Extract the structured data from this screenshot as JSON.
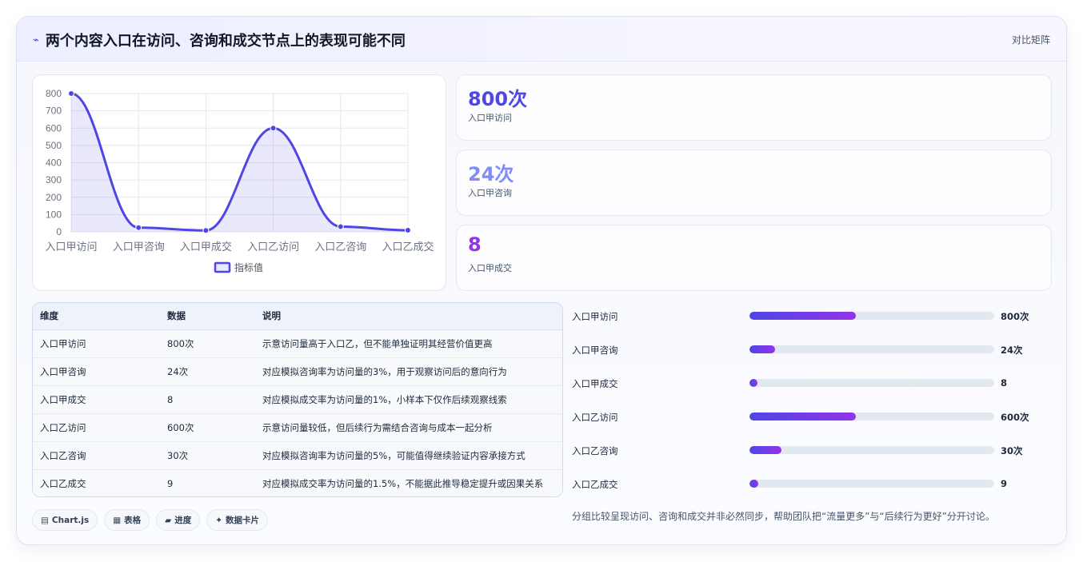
{
  "header": {
    "title": "两个内容入口在访问、咨询和成交节点上的表现可能不同",
    "title_icon": "trend-icon",
    "right_label": "对比矩阵"
  },
  "chart_data": {
    "type": "line",
    "categories": [
      "入口甲访问",
      "入口甲咨询",
      "入口甲成交",
      "入口乙访问",
      "入口乙咨询",
      "入口乙成交"
    ],
    "series": [
      {
        "name": "指标值",
        "values": [
          800,
          24,
          8,
          600,
          30,
          9
        ],
        "color": "#4f46e5"
      }
    ],
    "yticks": [
      "800",
      "700",
      "600",
      "500",
      "400",
      "300",
      "200",
      "100",
      "0"
    ],
    "ylim": [
      0,
      800
    ],
    "grid": true,
    "fill": true,
    "legend": "bottom"
  },
  "stats": [
    {
      "value": "800次",
      "label": "入口甲访问",
      "color": "#4f46e5"
    },
    {
      "value": "24次",
      "label": "入口甲咨询",
      "color": "#818cf8"
    },
    {
      "value": "8",
      "label": "入口甲成交",
      "color": "#9333ea"
    }
  ],
  "table": {
    "headers": [
      "维度",
      "数据",
      "说明"
    ],
    "rows": [
      [
        "入口甲访问",
        "800次",
        "示意访问量高于入口乙，但不能单独证明其经营价值更高"
      ],
      [
        "入口甲咨询",
        "24次",
        "对应模拟咨询率为访问量的3%，用于观察访问后的意向行为"
      ],
      [
        "入口甲成交",
        "8",
        "对应模拟成交率为访问量的1%，小样本下仅作后续观察线索"
      ],
      [
        "入口乙访问",
        "600次",
        "示意访问量较低，但后续行为需结合咨询与成本一起分析"
      ],
      [
        "入口乙咨询",
        "30次",
        "对应模拟咨询率为访问量的5%，可能值得继续验证内容承接方式"
      ],
      [
        "入口乙成交",
        "9",
        "对应模拟成交率为访问量的1.5%，不能据此推导稳定提升或因果关系"
      ]
    ]
  },
  "chips": [
    {
      "icon": "▤",
      "label": "Chart.js"
    },
    {
      "icon": "▦",
      "label": "表格"
    },
    {
      "icon": "▰",
      "label": "进度"
    },
    {
      "icon": "✦",
      "label": "数据卡片"
    }
  ],
  "bars": [
    {
      "label": "入口甲访问",
      "value_text": "800次",
      "fraction": 0.434
    },
    {
      "label": "入口甲咨询",
      "value_text": "24次",
      "fraction": 0.105
    },
    {
      "label": "入口甲成交",
      "value_text": "8",
      "fraction": 0.032
    },
    {
      "label": "入口乙访问",
      "value_text": "600次",
      "fraction": 0.434
    },
    {
      "label": "入口乙咨询",
      "value_text": "30次",
      "fraction": 0.131
    },
    {
      "label": "入口乙成交",
      "value_text": "9",
      "fraction": 0.036
    }
  ],
  "note": "分组比较呈现访问、咨询和成交并非必然同步，帮助团队把“流量更多”与“后续行为更好”分开讨论。"
}
